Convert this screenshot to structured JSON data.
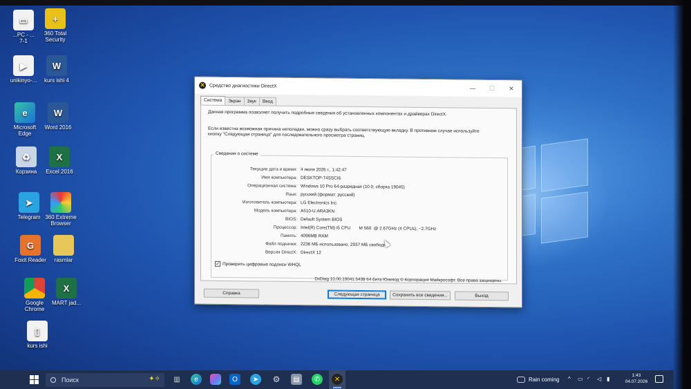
{
  "desktop": {
    "icons": [
      {
        "label": "...PC - ...\n7-1"
      },
      {
        "label": "360 Total\nSecurity"
      },
      {
        "label": "unikinyo-..."
      },
      {
        "label": "kurs ishi 4"
      },
      {
        "label": "Microsoft\nEdge"
      },
      {
        "label": "Word 2016"
      },
      {
        "label": "Корзина"
      },
      {
        "label": "Excel 2016"
      },
      {
        "label": "Telegram"
      },
      {
        "label": "360 Extreme\nBrowser"
      },
      {
        "label": "Foxit Reader"
      },
      {
        "label": "rasmlar"
      },
      {
        "label": "Google\nChrome"
      },
      {
        "label": "MART jad..."
      },
      {
        "label": "kurs ishi"
      }
    ]
  },
  "window": {
    "title": "Средство диагностики DirectX",
    "controls": {
      "minimize": "—",
      "maximize": "☐",
      "close": "✕"
    },
    "tabs": [
      {
        "label": "Система",
        "active": true
      },
      {
        "label": "Экран",
        "active": false
      },
      {
        "label": "Звук",
        "active": false
      },
      {
        "label": "Ввод",
        "active": false
      }
    ],
    "intro": "Данная программа позволяет получить подробные сведения об установленных компонентах и драйверах DirectX.",
    "hint_line1": "Если известна возможная причина неполадки, можно сразу выбрать соответствующую вкладку. В противном случае используйте",
    "hint_line2": "кнопку \"Следующая страница\" для последовательного просмотра страниц.",
    "group_title": "Сведения о системе",
    "info": [
      {
        "label": "Текущие дата и время:",
        "value": "4 июля 2026 г., 1:42:47"
      },
      {
        "label": "Имя компьютера:",
        "value": "DESKTOP-74SSCI6"
      },
      {
        "label": "Операционная система:",
        "value": "Windows 10 Pro 64-разрядная (10.0, сборка 19045)"
      },
      {
        "label": "Язык:",
        "value": "русский (формат: русский)"
      },
      {
        "label": "Изготовитель компьютера:",
        "value": "LG Electronics Inc."
      },
      {
        "label": "Модель компьютера:",
        "value": "A510-U.ARA3KN"
      },
      {
        "label": "BIOS:",
        "value": "Default System BIOS"
      },
      {
        "label": "Процессор:",
        "value": "Intel(R) Core(TM) i5 CPU       M 560  @ 2.67GHz (4 CPUs), ~2.7GHz"
      },
      {
        "label": "Память:",
        "value": "4096MB RAM"
      },
      {
        "label": "Файл подкачки:",
        "value": "2236 МБ использовано, 2937 МБ свободно"
      },
      {
        "label": "Версия DirectX:",
        "value": "DirectX 12"
      }
    ],
    "checkbox_label": "Проверить цифровые подписи WHQL",
    "checkbox_mark": "✓",
    "footer": "DxDiag 10.00.19041.5438 64 бита Юникод © Корпорация Майкрософт. Все права защищены.",
    "buttons": {
      "help": "Справка",
      "next": "Следующая страница",
      "save": "Сохранить все сведения...",
      "exit": "Выход"
    }
  },
  "taskbar": {
    "search_placeholder": "Поиск",
    "weather": "Rain coming",
    "time": "1:43",
    "date": "04.07.2026"
  }
}
